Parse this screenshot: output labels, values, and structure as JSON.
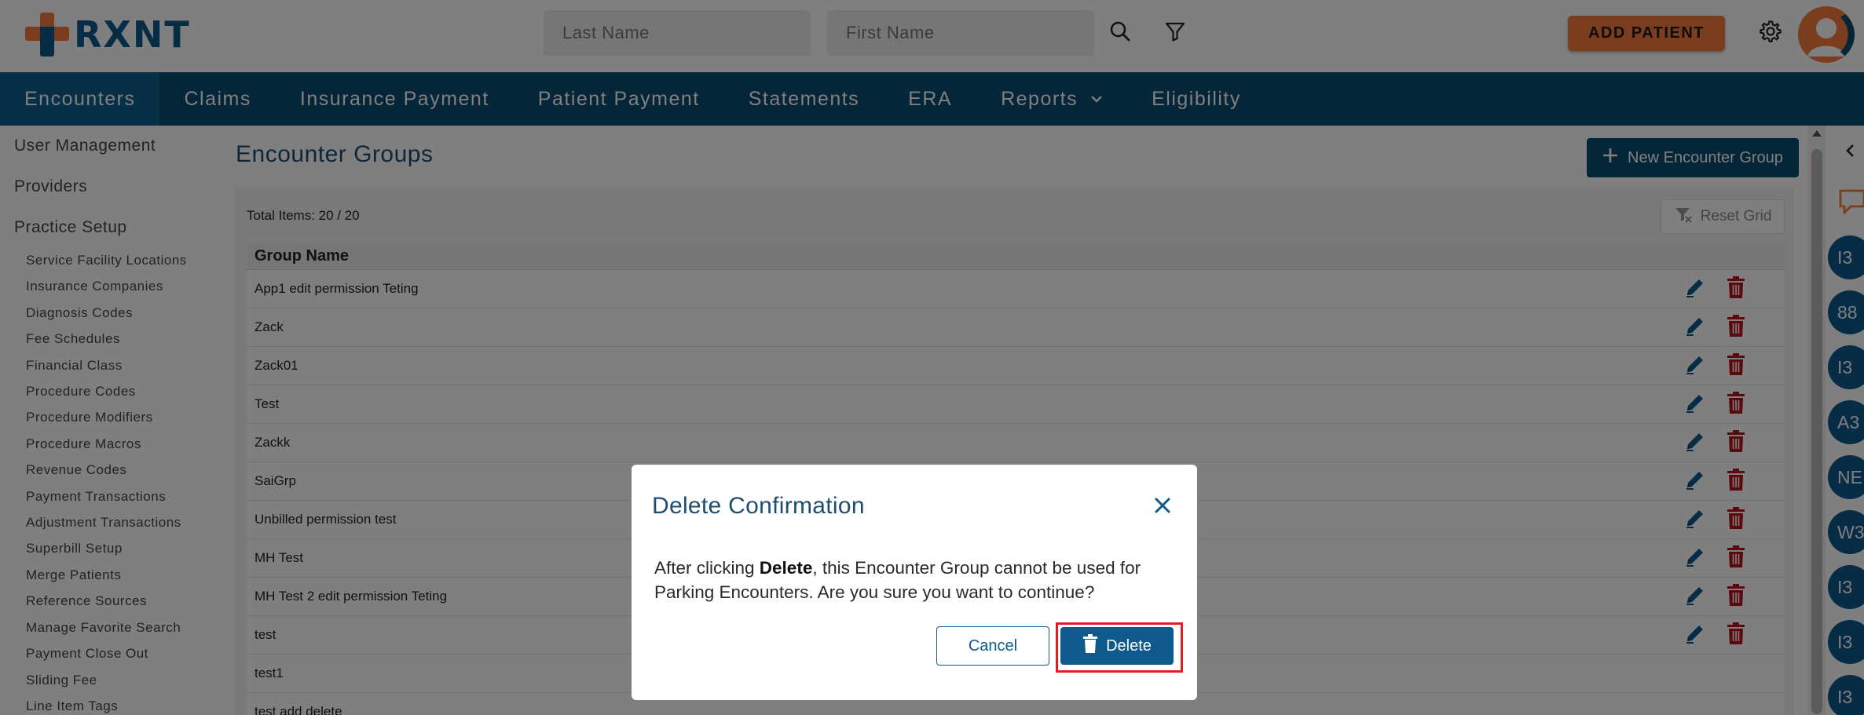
{
  "header": {
    "logo_text": "RXNT",
    "last_name_placeholder": "Last Name",
    "first_name_placeholder": "First Name",
    "add_patient_label": "ADD PATIENT"
  },
  "nav": {
    "items": [
      {
        "label": "Encounters",
        "active": true
      },
      {
        "label": "Claims"
      },
      {
        "label": "Insurance Payment"
      },
      {
        "label": "Patient Payment"
      },
      {
        "label": "Statements"
      },
      {
        "label": "ERA"
      },
      {
        "label": "Reports",
        "has_dropdown": true
      },
      {
        "label": "Eligibility"
      }
    ]
  },
  "sidebar": {
    "main_items": [
      "User Management",
      "Providers",
      "Practice Setup"
    ],
    "sub_items": [
      "Service Facility Locations",
      "Insurance Companies",
      "Diagnosis Codes",
      "Fee Schedules",
      "Financial Class",
      "Procedure Codes",
      "Procedure Modifiers",
      "Procedure Macros",
      "Revenue Codes",
      "Payment Transactions",
      "Adjustment Transactions",
      "Superbill Setup",
      "Merge Patients",
      "Reference Sources",
      "Manage Favorite Search",
      "Payment Close Out",
      "Sliding Fee",
      "Line Item Tags"
    ]
  },
  "main": {
    "title": "Encounter Groups",
    "new_group_label": "New Encounter Group",
    "total_items": "Total Items: 20 / 20",
    "reset_grid_label": "Reset Grid",
    "column_header": "Group Name",
    "rows": [
      "App1 edit permission Teting",
      "Zack",
      "Zack01",
      "Test",
      "Zackk",
      "SaiGrp",
      "Unbilled permission test",
      "MH Test",
      "MH Test 2 edit permission Teting",
      "test",
      "test1",
      "test add delete"
    ]
  },
  "right_rail": {
    "bubbles": [
      "I3",
      "88",
      "I3",
      "A3",
      "NE",
      "W3",
      "I3",
      "I3",
      "I3"
    ]
  },
  "modal": {
    "title": "Delete Confirmation",
    "message_prefix": "After clicking ",
    "message_bold": "Delete",
    "message_suffix": ", this Encounter Group cannot be used for Parking Encounters. Are you sure you want to continue?",
    "cancel_label": "Cancel",
    "delete_label": "Delete"
  },
  "colors": {
    "brand_orange": "#f47a3c",
    "brand_navy": "#0a4a72",
    "button_blue": "#0f5a8c",
    "delete_red": "#b5121b",
    "highlight_red": "#e01c24"
  }
}
